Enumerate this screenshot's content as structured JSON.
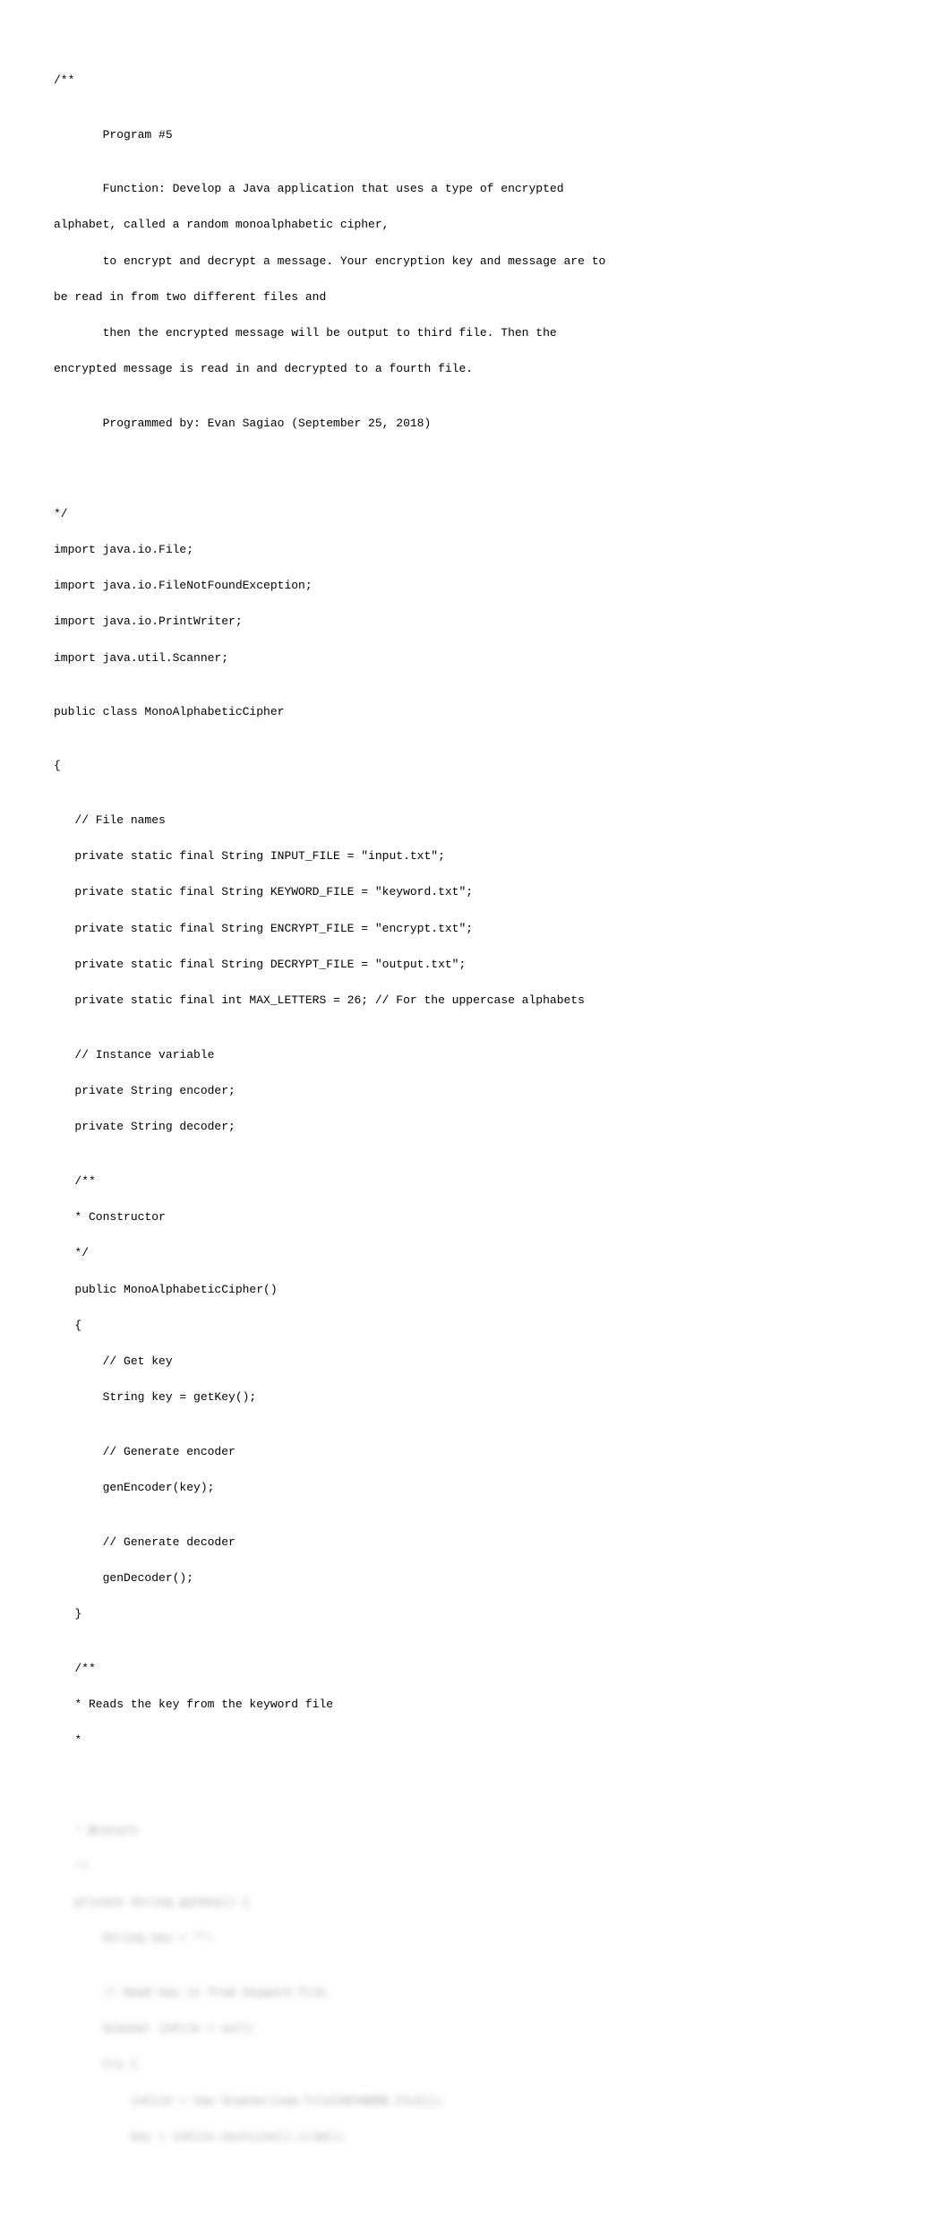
{
  "header": {
    "open": "/**",
    "blank1": "",
    "programLine": "       Program #5",
    "blank2": "",
    "functionLine1": "       Function: Develop a Java application that uses a type of encrypted",
    "functionLine2": "alphabet, called a random monoalphabetic cipher,",
    "functionLine3": "       to encrypt and decrypt a message. Your encryption key and message are to",
    "functionLine4": "be read in from two different files and",
    "functionLine5": "       then the encrypted message will be output to third file. Then the",
    "functionLine6": "encrypted message is read in and decrypted to a fourth file.",
    "blank3": "",
    "programmedBy": "       Programmed by: Evan Sagiao (September 25, 2018)",
    "blank4": "",
    "blank5": "",
    "blank6": "",
    "close": "*/"
  },
  "imports": {
    "i1": "import java.io.File;",
    "i2": "import java.io.FileNotFoundException;",
    "i3": "import java.io.PrintWriter;",
    "i4": "import java.util.Scanner;"
  },
  "classDecl": {
    "blank": "",
    "line": "public class MonoAlphabeticCipher",
    "blank2": "",
    "openBrace": "{"
  },
  "fileNames": {
    "blank": "",
    "comment": "   // File names",
    "f1": "   private static final String INPUT_FILE = \"input.txt\";",
    "f2": "   private static final String KEYWORD_FILE = \"keyword.txt\";",
    "f3": "   private static final String ENCRYPT_FILE = \"encrypt.txt\";",
    "f4": "   private static final String DECRYPT_FILE = \"output.txt\";",
    "f5": "   private static final int MAX_LETTERS = 26; // For the uppercase alphabets"
  },
  "instanceVars": {
    "blank": "",
    "comment": "   // Instance variable",
    "v1": "   private String encoder;",
    "v2": "   private String decoder;"
  },
  "constructor": {
    "blank": "",
    "docOpen": "   /**",
    "docLine": "   * Constructor",
    "docClose": "   */",
    "sig": "   public MonoAlphabeticCipher()",
    "open": "   {",
    "c1": "       // Get key",
    "c2": "       String key = getKey();",
    "blank2": "",
    "c3": "       // Generate encoder",
    "c4": "       genEncoder(key);",
    "blank3": "",
    "c5": "       // Generate decoder",
    "c6": "       genDecoder();",
    "close": "   }"
  },
  "readsKey": {
    "blank": "",
    "docOpen": "   /**",
    "docLine": "   * Reads the key from the keyword file",
    "star": "   *"
  },
  "blurred": {
    "b1": "   * @return",
    "b2": "   */",
    "b3": "   private String getKey() {",
    "b4": "       String key = \"\";",
    "b5": "",
    "b6": "       // Read key in from keyword file",
    "b7": "       Scanner inFile = null;",
    "b8": "       try {",
    "b9": "           inFile = new Scanner(new File(KEYWORD_FILE));",
    "b10": "           key = inFile.nextLine().trim();"
  }
}
